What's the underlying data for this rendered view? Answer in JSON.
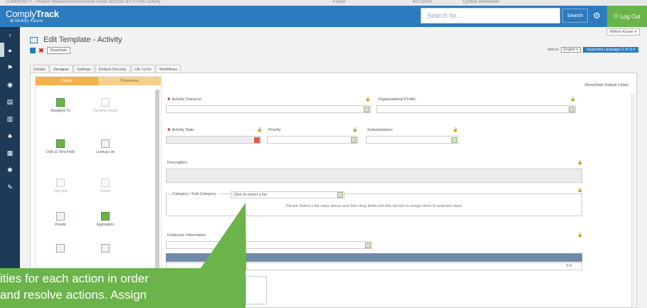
{
  "bg_strip": {
    "text": "COMMUNITY - Product Research/Assessment Funds 02/2016 at FX-PRO   Activity",
    "col1": "Expert",
    "col2": "8/17/2016",
    "col3": "Cynthia Winkelman"
  },
  "header": {
    "brand_prefix": "Comply",
    "brand_bold": "Track",
    "brand_sub": "Wolters Kluwer",
    "search_placeholder": "Search for...",
    "search_button": "Search",
    "logout": "Log Out"
  },
  "window": {
    "user_menu": "Wolters Kluwer ▾",
    "title": "Edit Template - Activity",
    "deactivate": "Deactivate",
    "view_in_label": "View in",
    "view_in_value": "English ▾",
    "supported_language": "Supported Language (1 of 1) ▾"
  },
  "tabs": [
    "Details",
    "Designer",
    "Settings",
    "Default Security",
    "Life Cycle",
    "Workflows"
  ],
  "palette": {
    "tab_fields": "Fields",
    "tab_properties": "Properties",
    "items": [
      {
        "label": "Assigned To"
      },
      {
        "label": "Dynamic Fields"
      },
      {
        "label": "Date & Time Field"
      },
      {
        "label": "Lookup List"
      },
      {
        "label": "Org Unit"
      },
      {
        "label": "Owner"
      },
      {
        "label": "People"
      },
      {
        "label": "Aggregator"
      }
    ]
  },
  "form": {
    "show_hide": "Show/Hide Default Fields",
    "activity_owner": "Activity Owner(s):",
    "org_profile": "Organizational Profile:",
    "activity_date": "Activity Date:",
    "priority": "Priority:",
    "substantiation": "Substantiation:",
    "description": "Description:",
    "category_label": "Category / Sub-Category:",
    "category_select": "Click to select a list",
    "category_msg": "Please Select a list value above and then drag fields into this section to assign them to selected value",
    "employee_info": "Employee Information:",
    "grid_row_right": "0 ▾"
  },
  "callout": {
    "line1": "ities for each action in order",
    "line2": "and resolve actions. Assign"
  }
}
